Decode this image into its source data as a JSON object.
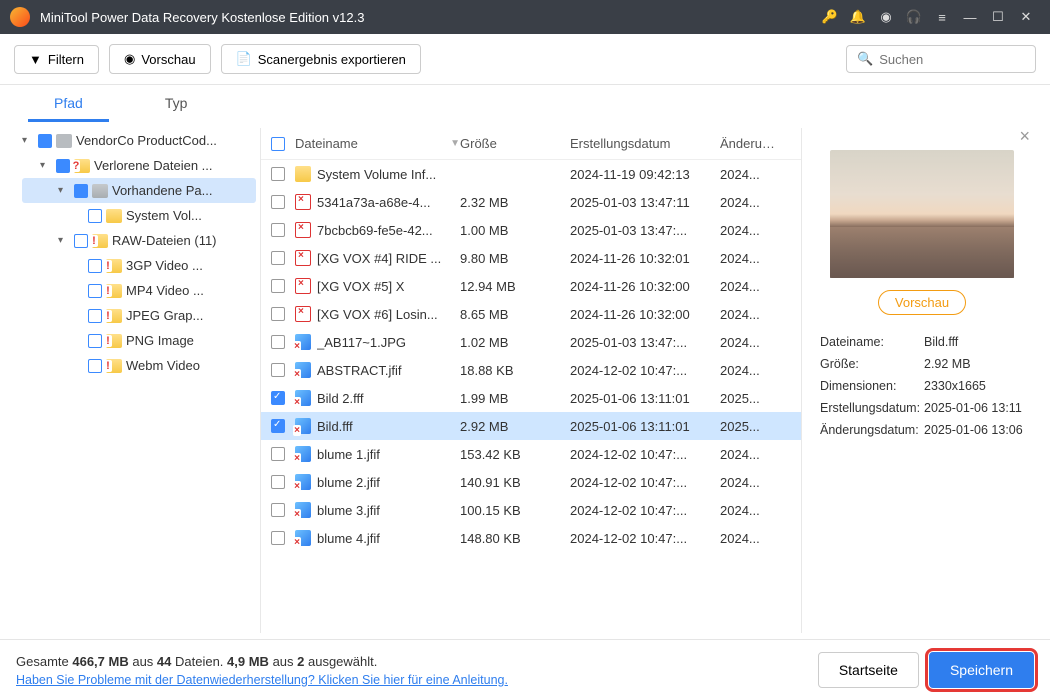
{
  "titlebar": {
    "title": "MiniTool Power Data Recovery Kostenlose Edition v12.3"
  },
  "toolbar": {
    "filter": "Filtern",
    "preview": "Vorschau",
    "export": "Scanergebnis exportieren",
    "search_placeholder": "Suchen"
  },
  "tabs": {
    "path": "Pfad",
    "type": "Typ"
  },
  "tree": {
    "root": "VendorCo ProductCod...",
    "lost": "Verlorene Dateien ...",
    "existing": "Vorhandene Pa...",
    "sysvol": "System Vol...",
    "raw": "RAW-Dateien (11)",
    "items": [
      "3GP Video ...",
      "MP4 Video ...",
      "JPEG Grap...",
      "PNG Image",
      "Webm Video"
    ]
  },
  "columns": {
    "name": "Dateiname",
    "size": "Größe",
    "created": "Erstellungsdatum",
    "modified": "Änderungs"
  },
  "files": [
    {
      "icon": "folder",
      "name": "System Volume Inf...",
      "size": "",
      "created": "2024-11-19 09:42:13",
      "mod": "2024...",
      "checked": false
    },
    {
      "icon": "file",
      "name": "5341a73a-a68e-4...",
      "size": "2.32 MB",
      "created": "2025-01-03 13:47:11",
      "mod": "2024...",
      "checked": false
    },
    {
      "icon": "file",
      "name": "7bcbcb69-fe5e-42...",
      "size": "1.00 MB",
      "created": "2025-01-03 13:47:...",
      "mod": "2024...",
      "checked": false
    },
    {
      "icon": "file",
      "name": "[XG VOX #4] RIDE ...",
      "size": "9.80 MB",
      "created": "2024-11-26 10:32:01",
      "mod": "2024...",
      "checked": false
    },
    {
      "icon": "file",
      "name": "[XG VOX #5] X",
      "size": "12.94 MB",
      "created": "2024-11-26 10:32:00",
      "mod": "2024...",
      "checked": false
    },
    {
      "icon": "file",
      "name": "[XG VOX #6] Losin...",
      "size": "8.65 MB",
      "created": "2024-11-26 10:32:00",
      "mod": "2024...",
      "checked": false
    },
    {
      "icon": "img",
      "name": "_AB117~1.JPG",
      "size": "1.02 MB",
      "created": "2025-01-03 13:47:...",
      "mod": "2024...",
      "checked": false
    },
    {
      "icon": "img",
      "name": "ABSTRACT.jfif",
      "size": "18.88 KB",
      "created": "2024-12-02 10:47:...",
      "mod": "2024...",
      "checked": false
    },
    {
      "icon": "img",
      "name": "Bild 2.fff",
      "size": "1.99 MB",
      "created": "2025-01-06 13:11:01",
      "mod": "2025...",
      "checked": true
    },
    {
      "icon": "img",
      "name": "Bild.fff",
      "size": "2.92 MB",
      "created": "2025-01-06 13:11:01",
      "mod": "2025...",
      "checked": true,
      "selected": true
    },
    {
      "icon": "img",
      "name": "blume 1.jfif",
      "size": "153.42 KB",
      "created": "2024-12-02 10:47:...",
      "mod": "2024...",
      "checked": false
    },
    {
      "icon": "img",
      "name": "blume 2.jfif",
      "size": "140.91 KB",
      "created": "2024-12-02 10:47:...",
      "mod": "2024...",
      "checked": false
    },
    {
      "icon": "img",
      "name": "blume 3.jfif",
      "size": "100.15 KB",
      "created": "2024-12-02 10:47:...",
      "mod": "2024...",
      "checked": false
    },
    {
      "icon": "img",
      "name": "blume 4.jfif",
      "size": "148.80 KB",
      "created": "2024-12-02 10:47:...",
      "mod": "2024...",
      "checked": false
    }
  ],
  "preview": {
    "button": "Vorschau",
    "meta": {
      "filename_k": "Dateiname:",
      "filename_v": "Bild.fff",
      "size_k": "Größe:",
      "size_v": "2.92 MB",
      "dim_k": "Dimensionen:",
      "dim_v": "2330x1665",
      "created_k": "Erstellungsdatum:",
      "created_v": "2025-01-06 13:11",
      "modified_k": "Änderungsdatum:",
      "modified_v": "2025-01-06 13:06"
    }
  },
  "footer": {
    "stats_prefix": "Gesamte ",
    "stats_total": "466,7 MB",
    "stats_mid1": " aus ",
    "stats_files": "44",
    "stats_mid2": " Dateien.  ",
    "stats_sel": "4,9 MB",
    "stats_mid3": " aus ",
    "stats_selcount": "2",
    "stats_suffix": " ausgewählt.",
    "help": "Haben Sie Probleme mit der Datenwiederherstellung? Klicken Sie hier für eine Anleitung.",
    "home": "Startseite",
    "save": "Speichern"
  }
}
